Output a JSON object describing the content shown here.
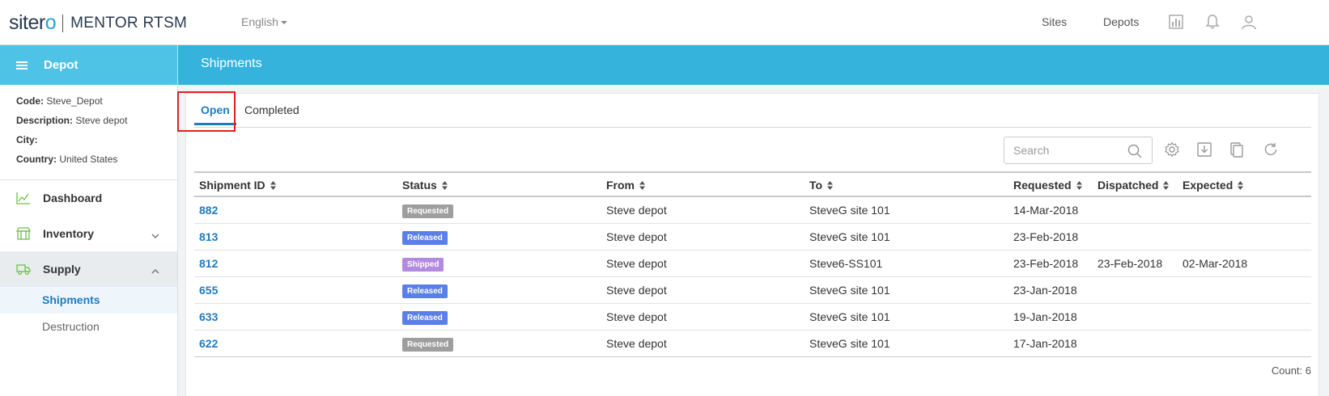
{
  "header": {
    "logo_brand_a": "siter",
    "logo_brand_b": "o",
    "logo_product": "MENTOR RTSM",
    "language": "English",
    "links": [
      "Sites",
      "Depots"
    ]
  },
  "sidebar": {
    "title": "Depot",
    "info": [
      {
        "label": "Code:",
        "value": "Steve_Depot"
      },
      {
        "label": "Description:",
        "value": "Steve depot"
      },
      {
        "label": "City:",
        "value": ""
      },
      {
        "label": "Country:",
        "value": "United States"
      }
    ],
    "nav": [
      {
        "label": "Dashboard",
        "icon": "chart-line-icon"
      },
      {
        "label": "Inventory",
        "icon": "inventory-icon"
      },
      {
        "label": "Supply",
        "icon": "truck-icon"
      }
    ],
    "sub": [
      {
        "label": "Shipments"
      },
      {
        "label": "Destruction"
      }
    ]
  },
  "page": {
    "title": "Shipments",
    "tabs": [
      {
        "label": "Open"
      },
      {
        "label": "Completed"
      }
    ],
    "search_placeholder": "Search"
  },
  "table": {
    "columns": [
      "Shipment ID",
      "Status",
      "From",
      "To",
      "Requested",
      "Dispatched",
      "Expected"
    ],
    "rows": [
      {
        "id": "882",
        "status": "Requested",
        "from": "Steve depot",
        "to": "SteveG site 101",
        "requested": "14-Mar-2018",
        "dispatched": "",
        "expected": ""
      },
      {
        "id": "813",
        "status": "Released",
        "from": "Steve depot",
        "to": "SteveG site 101",
        "requested": "23-Feb-2018",
        "dispatched": "",
        "expected": ""
      },
      {
        "id": "812",
        "status": "Shipped",
        "from": "Steve depot",
        "to": "Steve6-SS101",
        "requested": "23-Feb-2018",
        "dispatched": "23-Feb-2018",
        "expected": "02-Mar-2018"
      },
      {
        "id": "655",
        "status": "Released",
        "from": "Steve depot",
        "to": "SteveG site 101",
        "requested": "23-Jan-2018",
        "dispatched": "",
        "expected": ""
      },
      {
        "id": "633",
        "status": "Released",
        "from": "Steve depot",
        "to": "SteveG site 101",
        "requested": "19-Jan-2018",
        "dispatched": "",
        "expected": ""
      },
      {
        "id": "622",
        "status": "Requested",
        "from": "Steve depot",
        "to": "SteveG site 101",
        "requested": "17-Jan-2018",
        "dispatched": "",
        "expected": ""
      }
    ],
    "count_label": "Count: 6"
  },
  "colors": {
    "brand_blue": "#36b3dc",
    "sidebar_head": "#4fc3e6",
    "link_blue": "#1e7cc0",
    "status_requested": "#9e9e9e",
    "status_released": "#5b7fe8",
    "status_shipped": "#b28be0",
    "highlight_red": "#e02020"
  }
}
